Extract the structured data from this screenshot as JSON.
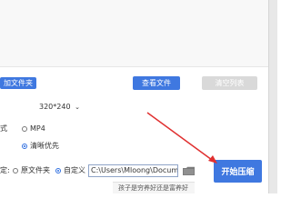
{
  "toolbar": {
    "folder_button": "加文件夹",
    "view_files_button": "查看文件",
    "clear_list_button": "清空列表"
  },
  "settings": {
    "resolution_value": "320*240",
    "format_label": "式",
    "format_option": "MP4",
    "quality_option": "清晰优先",
    "output_label": "定:",
    "original_folder_option": "原文件夹",
    "custom_option": "自定义",
    "output_path": "C:\\Users\\Mloong\\Docume"
  },
  "actions": {
    "start_compress": "开始压缩"
  },
  "tooltip": {
    "text": "孩子是穷养好还是富养好"
  },
  "icons": {
    "dropdown": "chevron-down-icon",
    "folder": "folder-icon",
    "arrow": "red-arrow-icon"
  },
  "colors": {
    "accent": "#3f78e0",
    "disabled": "#d9d9d9",
    "arrow": "#e03030"
  }
}
